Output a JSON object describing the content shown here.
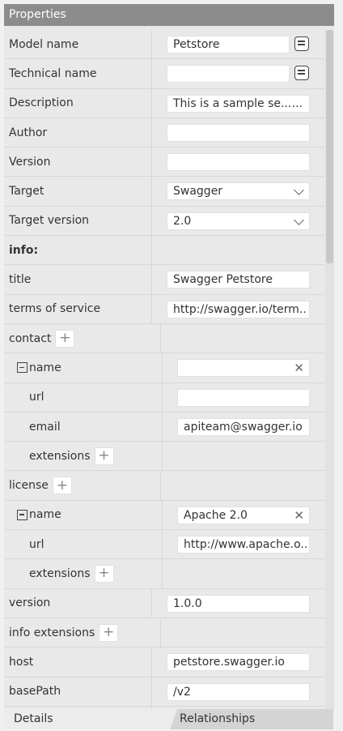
{
  "panel_title": "Properties",
  "rows": {
    "model_name": {
      "label": "Model name",
      "value": "Petstore"
    },
    "technical_name": {
      "label": "Technical name",
      "value": ""
    },
    "description": {
      "label": "Description",
      "value": "This is a sample se...",
      "ellipsis": "..."
    },
    "author": {
      "label": "Author",
      "value": ""
    },
    "version": {
      "label": "Version",
      "value": ""
    },
    "target": {
      "label": "Target",
      "value": "Swagger"
    },
    "target_version": {
      "label": "Target version",
      "value": "2.0"
    },
    "info": {
      "label": "info:"
    },
    "title": {
      "label": "title",
      "value": "Swagger Petstore"
    },
    "terms": {
      "label": "terms of service",
      "value": "http://swagger.io/term.."
    },
    "contact": {
      "label": "contact"
    },
    "contact_name": {
      "label": "name",
      "value": ""
    },
    "contact_url": {
      "label": "url",
      "value": ""
    },
    "contact_email": {
      "label": "email",
      "value": "apiteam@swagger.io"
    },
    "contact_extensions": {
      "label": "extensions"
    },
    "license": {
      "label": "license"
    },
    "license_name": {
      "label": "name",
      "value": "Apache 2.0"
    },
    "license_url": {
      "label": "url",
      "value": "http://www.apache.o.."
    },
    "license_extensions": {
      "label": "extensions"
    },
    "info_version": {
      "label": "version",
      "value": "1.0.0"
    },
    "info_extensions": {
      "label": "info extensions"
    },
    "host": {
      "label": "host",
      "value": "petstore.swagger.io"
    },
    "basepath": {
      "label": "basePath",
      "value": "/v2"
    }
  },
  "icons": {
    "plus": "+",
    "clear": "✕"
  },
  "tabs": {
    "details": "Details",
    "relationships": "Relationships"
  },
  "colors": {
    "header_bg": "#8c8c8c",
    "panel_bg": "#e9e9e9",
    "field_bg": "#ffffff"
  }
}
